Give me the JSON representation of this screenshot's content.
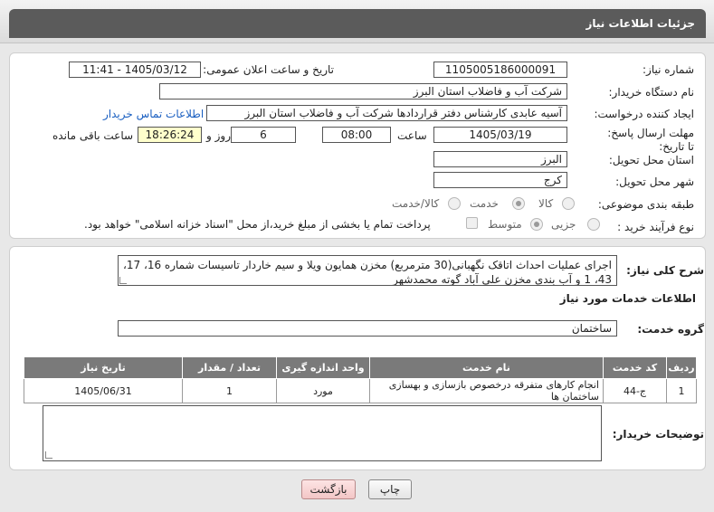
{
  "header": {
    "title": "جزئیات اطلاعات نیاز"
  },
  "info": {
    "need_number_label": "شماره نیاز:",
    "need_number": "1105005186000091",
    "announce_label": "تاریخ و ساعت اعلان عمومی:",
    "announce_value": "1405/03/12 - 11:41",
    "buyer_org_label": "نام دستگاه خریدار:",
    "buyer_org": "شرکت آب و فاضلاب استان البرز",
    "creator_label": "ایجاد کننده درخواست:",
    "creator": "آسیه عابدی کارشناس دفتر قراردادها شرکت آب و فاضلاب استان البرز",
    "contact_link": "اطلاعات تماس خریدار",
    "deadline_label": "مهلت ارسال پاسخ: تا تاریخ:",
    "deadline_date": "1405/03/19",
    "time_label": "ساعت",
    "deadline_time": "08:00",
    "days_value": "6",
    "days_label": "روز و",
    "remaining_time": "18:26:24",
    "remaining_label": "ساعت باقی مانده",
    "province_label": "استان محل تحویل:",
    "province": "البرز",
    "city_label": "شهر محل تحویل:",
    "city": "کرج",
    "category_label": "طبقه بندی موضوعی:",
    "category_options": [
      "کالا",
      "خدمت",
      "کالا/خدمت"
    ],
    "process_label": "نوع فرآیند خرید :",
    "process_options": [
      "جزیی",
      "متوسط"
    ],
    "payment_note": "پرداخت تمام یا بخشی از مبلغ خرید،از محل \"اسناد خزانه اسلامی\" خواهد بود."
  },
  "details": {
    "summary_label": "شرح کلی نیاز:",
    "summary_line1": "اجرای عملیات احداث اتاقک نگهبانی(30 مترمربع) مخزن همایون ویلا و سیم خاردار تاسیسات شماره 16، 17،",
    "summary_line2": "43، 1 و آب بندی مخزن علی آباد گوته محمدشهر",
    "services_title": "اطلاعات خدمات مورد نیاز",
    "service_group_label": "گروه خدمت:",
    "service_group": "ساختمان"
  },
  "table": {
    "headers": [
      "ردیف",
      "کد خدمت",
      "نام خدمت",
      "واحد اندازه گیری",
      "تعداد / مقدار",
      "تاریخ نیاز"
    ],
    "rows": [
      [
        "1",
        "ج-44",
        "انجام کارهای متفرقه درخصوص بازسازی و بهسازی ساختمان ها",
        "مورد",
        "1",
        "1405/06/31"
      ]
    ]
  },
  "buyer_notes_label": "توضیحات خریدار:",
  "buttons": {
    "print": "چاپ",
    "back": "بازگشت"
  },
  "colors": {
    "header_bg": "#5b5b5b",
    "link": "#1a5fc1",
    "yellow_field": "#ffffcc"
  }
}
